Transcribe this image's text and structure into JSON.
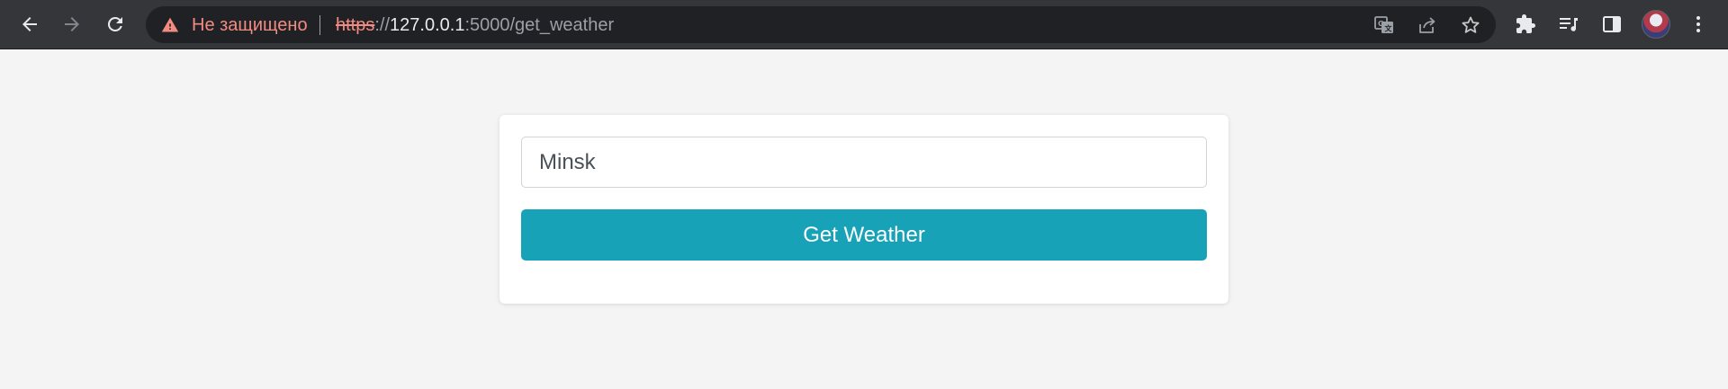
{
  "browser": {
    "security_warning": "Не защищено",
    "url": {
      "scheme": "https",
      "separator": "://",
      "host": "127.0.0.1",
      "path": ":5000/get_weather"
    },
    "colors": {
      "toolbar_bg": "#35363a",
      "omnibox_bg": "#202124",
      "warning": "#f28b82"
    }
  },
  "form": {
    "city_value": "Minsk",
    "submit_label": "Get Weather",
    "button_color": "#17a2b8"
  }
}
